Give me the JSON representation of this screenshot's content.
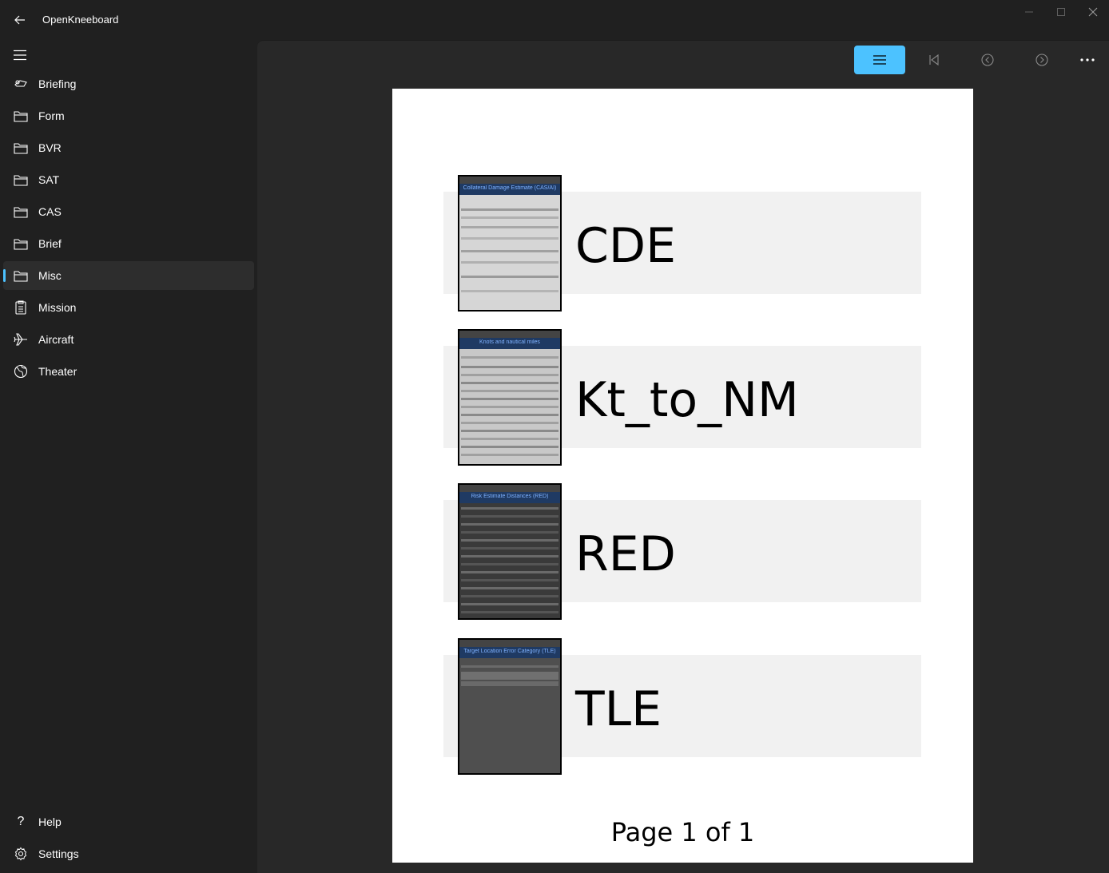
{
  "window": {
    "title": "OpenKneeboard"
  },
  "sidebar": {
    "items": [
      {
        "label": "Briefing",
        "icon": "briefing-icon"
      },
      {
        "label": "Form",
        "icon": "folder-icon"
      },
      {
        "label": "BVR",
        "icon": "folder-icon"
      },
      {
        "label": "SAT",
        "icon": "folder-icon"
      },
      {
        "label": "CAS",
        "icon": "folder-icon"
      },
      {
        "label": "Brief",
        "icon": "folder-icon"
      },
      {
        "label": "Misc",
        "icon": "folder-icon",
        "selected": true
      },
      {
        "label": "Mission",
        "icon": "mission-icon"
      },
      {
        "label": "Aircraft",
        "icon": "aircraft-icon"
      },
      {
        "label": "Theater",
        "icon": "globe-icon"
      }
    ],
    "footer": [
      {
        "label": "Help",
        "icon": "help-icon"
      },
      {
        "label": "Settings",
        "icon": "settings-icon"
      }
    ]
  },
  "toolbar": {
    "buttons": [
      "contents-icon",
      "first-page-icon",
      "previous-page-icon",
      "next-page-icon",
      "more-icon"
    ]
  },
  "page": {
    "entries": [
      {
        "label": "CDE",
        "thumb_title": "Collateral Damage Estimate (CAS/AI)",
        "thumb_style": "light"
      },
      {
        "label": "Kt_to_NM",
        "thumb_title": "Knots and nautical miles",
        "thumb_style": "table"
      },
      {
        "label": "RED",
        "thumb_title": "Risk Estimate Distances (RED)",
        "thumb_style": "dark"
      },
      {
        "label": "TLE",
        "thumb_title": "Target Location Error Category (TLE)",
        "thumb_style": "sparse"
      }
    ],
    "footer": "Page 1 of 1"
  },
  "colors": {
    "accent": "#4cc2ff",
    "background": "#202020",
    "content_background": "#282828"
  }
}
